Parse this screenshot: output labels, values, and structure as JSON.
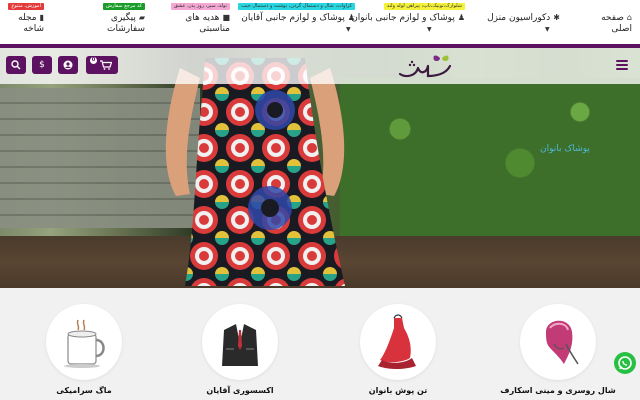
{
  "nav": {
    "items": [
      {
        "label": "صفحه",
        "label2": "اصلی",
        "icon": "home-icon"
      },
      {
        "label": "دکوراسیون منزل",
        "icon": "star-icon",
        "caret": true
      },
      {
        "label": "پوشاک و لوازم جانبی بانوان",
        "icon": "person-icon",
        "caret": true,
        "badge": "شلوارک،تونیک،تاپ، پیراهن لوله ولند"
      },
      {
        "label": "پوشاک و لوازم جانبی آقایان",
        "icon": "person-icon",
        "caret": true,
        "badge": "کراوات، شال و دستمال گردن، پوشت و دستمال جیب"
      },
      {
        "label": "هدیه های",
        "label2": "مناسبتی",
        "icon": "gift-icon",
        "badge": "تولد، سپر، روز پدر، عشق"
      },
      {
        "label": "پیگیری",
        "label2": "سفارشات",
        "icon": "truck-icon",
        "badge": "کد مرجع سفارش"
      },
      {
        "label": "مجله",
        "label2": "شاخه",
        "icon": "book-icon",
        "badge": "آموزش، متنوع"
      }
    ]
  },
  "colors": {
    "brand": "#5c1260",
    "badge_yellow": "#f4f13a",
    "badge_cyan": "#27d6e0",
    "badge_pink": "#f4a7d3",
    "badge_green": "#1a9c2a",
    "badge_red": "#e43a3a",
    "caption": "#4fb7d8",
    "whatsapp": "#28c043"
  },
  "header": {
    "logo_text": "شاخه",
    "cart_count": "0",
    "icons": [
      "cart-icon",
      "user-icon",
      "dollar-icon",
      "search-icon"
    ]
  },
  "hero": {
    "caption": "پوشاک بانوان"
  },
  "categories": [
    {
      "label": "شال روسری و مینی اسکارف",
      "icon": "scarf-icon"
    },
    {
      "label": "تن پوش بانوان",
      "icon": "dress-icon"
    },
    {
      "label": "اکسسوری آقایان",
      "icon": "suit-icon"
    },
    {
      "label": "ماگ سرامیکی",
      "icon": "mug-icon"
    }
  ]
}
